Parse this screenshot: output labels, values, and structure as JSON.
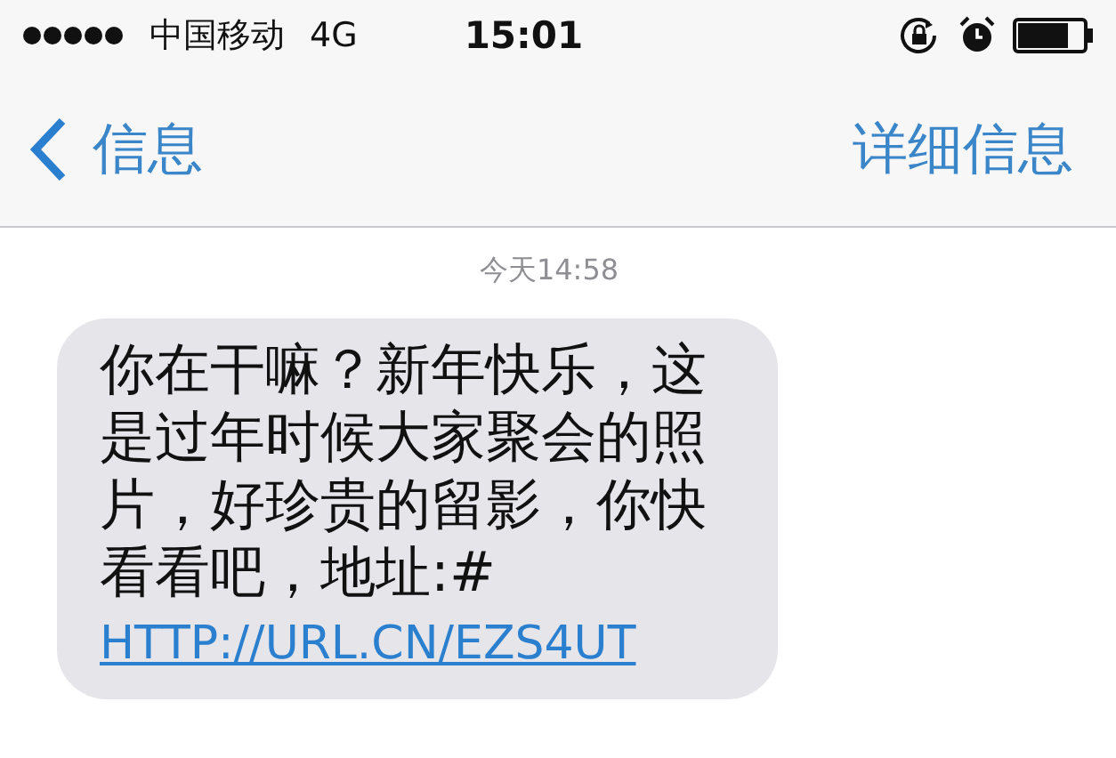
{
  "status_bar": {
    "carrier": "中国移动",
    "network": "4G",
    "time": "15:01"
  },
  "nav": {
    "back": "信息",
    "action": "详细信息"
  },
  "timestamp": "今天14:58",
  "message": {
    "text": "你在干嘛？新年快乐，这是过年时候大家聚会的照片，好珍贵的留影，你快看看吧，地址:#",
    "link": "HTTP://URL.CN/EZS4UT"
  }
}
